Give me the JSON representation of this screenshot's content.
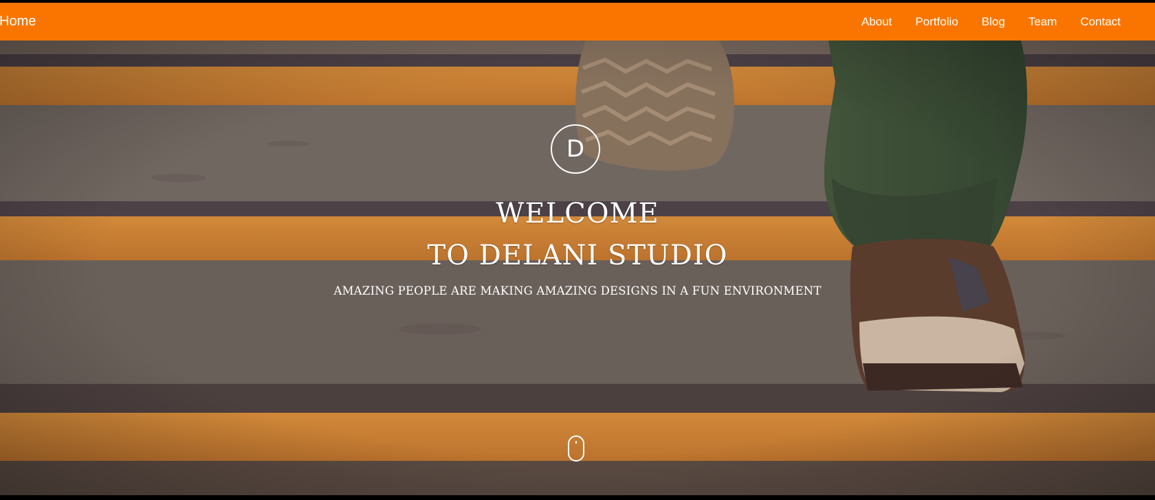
{
  "navbar": {
    "brand": "Home",
    "links": [
      "About",
      "Portfolio",
      "Blog",
      "Team",
      "Contact"
    ],
    "background_color": "#fa7500"
  },
  "hero": {
    "logo_letter": "D",
    "title_line_1": "WELCOME",
    "title_line_2": "TO DELANI STUDIO",
    "subtitle": "AMAZING PEOPLE ARE MAKING AMAZING DESIGNS IN A FUN ENVIRONMENT",
    "background_image": "stair-steps-with-sneakers-photo",
    "scroll_icon": "mouse-scroll-icon"
  }
}
